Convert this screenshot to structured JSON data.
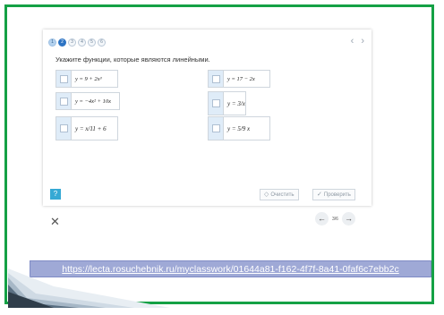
{
  "lesson": {
    "steps": [
      {
        "label": "1",
        "state": "done"
      },
      {
        "label": "2",
        "state": "active"
      },
      {
        "label": "3",
        "state": "todo"
      },
      {
        "label": "4",
        "state": "todo"
      },
      {
        "label": "5",
        "state": "todo"
      },
      {
        "label": "6",
        "state": "todo"
      }
    ],
    "prev_arrow": "‹",
    "next_arrow": "›",
    "question": "Укажите функции, которые являются линейными.",
    "options": [
      {
        "formula": "y = 9 + 2x³"
      },
      {
        "formula": "y = 17 − 2x"
      },
      {
        "formula": "y = −4x² + 10x"
      },
      {
        "formula": "y = 3/x"
      },
      {
        "formula": "y = x/11 + 6"
      },
      {
        "formula": "y = 5/9 x"
      }
    ],
    "help_label": "?",
    "clear_label": "Очистить",
    "check_label": "Проверить"
  },
  "footer_nav": {
    "close_glyph": "✕",
    "back_glyph": "←",
    "forward_glyph": "→",
    "page_counter": "3/6"
  },
  "link": {
    "url": "https://lecta.rosuchebnik.ru/myclasswork/01644a81-f162-4f7f-8a41-0faf6c7ebb2c"
  },
  "colors": {
    "frame": "#14a145",
    "url_background": "#9fa9d6",
    "active_step": "#2d74c4",
    "help_button": "#36a9d4"
  }
}
